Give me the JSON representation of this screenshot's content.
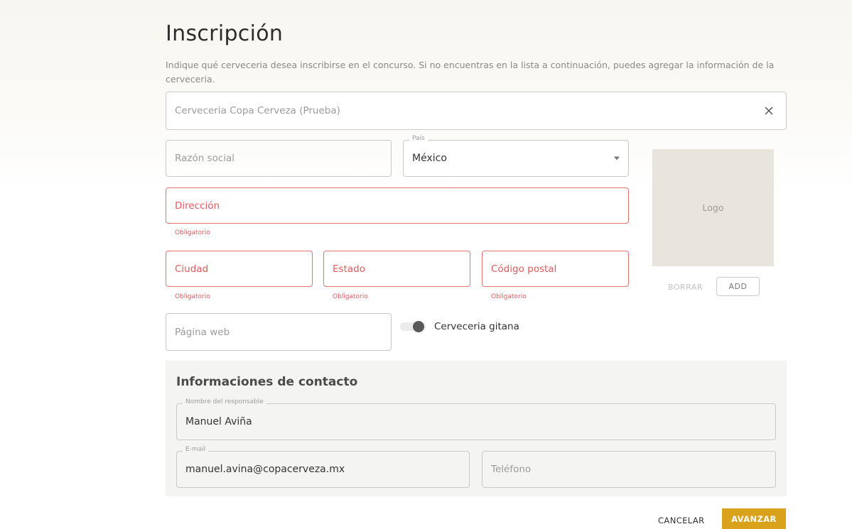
{
  "header": {
    "title": "Inscripción",
    "description": "Indique qué cerveceria desea inscribirse en el concurso. Si no encuentras en la lista a continuación, puedes agregar la información de la cerveceria."
  },
  "brewery_select": {
    "value": "Cerveceria Copa Cerveza (Prueba)",
    "clear_icon": "close-icon"
  },
  "form": {
    "razon_social": {
      "placeholder": "Razón social"
    },
    "pais": {
      "legend": "País",
      "value": "México"
    },
    "direccion": {
      "placeholder": "Dirección",
      "error": "Obligatorio"
    },
    "ciudad": {
      "placeholder": "Ciudad",
      "error": "Obligatorio"
    },
    "estado": {
      "placeholder": "Estado",
      "error": "Obligatorio"
    },
    "codigo_postal": {
      "placeholder": "Código postal",
      "error": "Obligatorio"
    },
    "pagina_web": {
      "placeholder": "Página web"
    },
    "cerveceria_gitana": {
      "label": "Cerveceria gitana",
      "checked": false
    }
  },
  "logo": {
    "label": "Logo",
    "delete_label": "BORRAR",
    "add_label": "ADD"
  },
  "contact": {
    "title": "Informaciones de contacto",
    "responsable": {
      "legend": "Nombre del responsable",
      "value": "Manuel Aviña"
    },
    "email": {
      "legend": "E-mail",
      "value": "manuel.avina@copacerveza.mx"
    },
    "telefono": {
      "placeholder": "Teléfono"
    }
  },
  "actions": {
    "cancel_label": "CANCELAR",
    "next_label": "AVANZAR"
  },
  "colors": {
    "accent": "#d9a21a",
    "error": "#e35b5b",
    "logo_bg": "#e8e5de",
    "contact_bg": "#f4f4f3"
  }
}
